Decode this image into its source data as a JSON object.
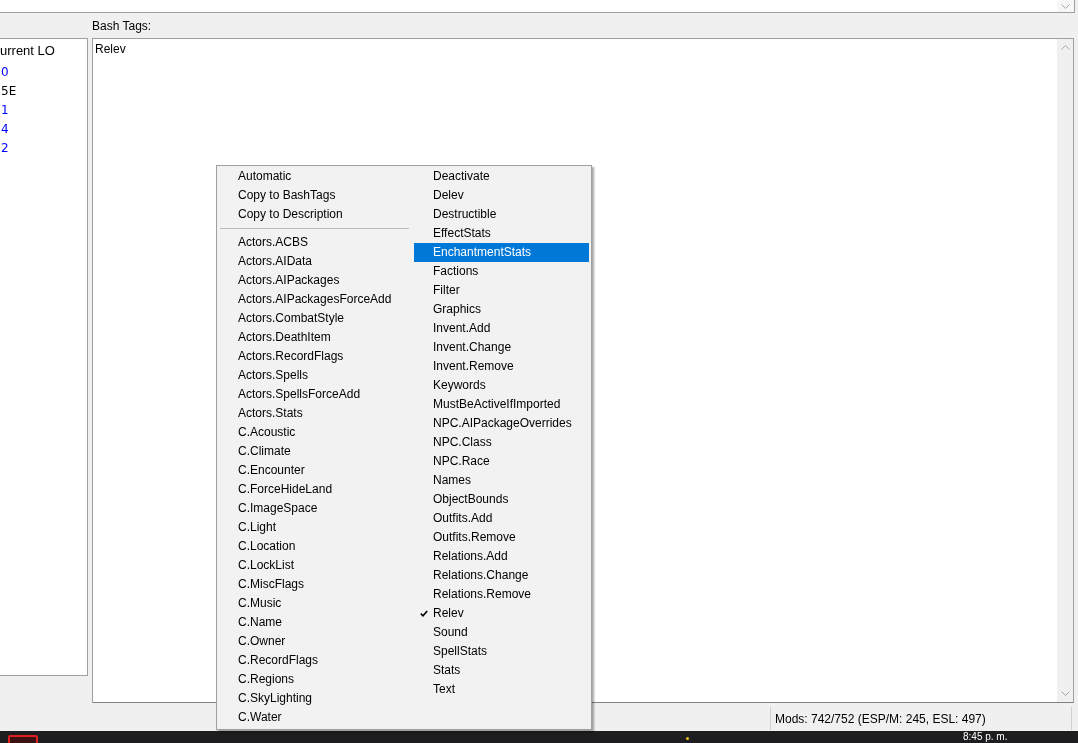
{
  "bash_tags": {
    "label": "Bash Tags:",
    "value": "Relev"
  },
  "load_order": {
    "header": "urrent LO",
    "rows": [
      {
        "text": "0",
        "color": "#0000ff"
      },
      {
        "text": "5E",
        "color": "#000000"
      },
      {
        "text": "1",
        "color": "#0000ff"
      },
      {
        "text": "4",
        "color": "#0000ff"
      },
      {
        "text": "2",
        "color": "#0000ff"
      }
    ]
  },
  "context_menu": {
    "columns": [
      {
        "items": [
          {
            "kind": "action",
            "label": "Automatic",
            "highlighted": false
          },
          {
            "kind": "action",
            "label": "Copy to BashTags",
            "highlighted": false
          },
          {
            "kind": "action",
            "label": "Copy to Description",
            "highlighted": false
          },
          {
            "kind": "separator"
          },
          {
            "kind": "tag",
            "label": "Actors.ACBS",
            "checked": false,
            "highlighted": false
          },
          {
            "kind": "tag",
            "label": "Actors.AIData",
            "checked": false,
            "highlighted": false
          },
          {
            "kind": "tag",
            "label": "Actors.AIPackages",
            "checked": false,
            "highlighted": false
          },
          {
            "kind": "tag",
            "label": "Actors.AIPackagesForceAdd",
            "checked": false,
            "highlighted": false
          },
          {
            "kind": "tag",
            "label": "Actors.CombatStyle",
            "checked": false,
            "highlighted": false
          },
          {
            "kind": "tag",
            "label": "Actors.DeathItem",
            "checked": false,
            "highlighted": false
          },
          {
            "kind": "tag",
            "label": "Actors.RecordFlags",
            "checked": false,
            "highlighted": false
          },
          {
            "kind": "tag",
            "label": "Actors.Spells",
            "checked": false,
            "highlighted": false
          },
          {
            "kind": "tag",
            "label": "Actors.SpellsForceAdd",
            "checked": false,
            "highlighted": false
          },
          {
            "kind": "tag",
            "label": "Actors.Stats",
            "checked": false,
            "highlighted": false
          },
          {
            "kind": "tag",
            "label": "C.Acoustic",
            "checked": false,
            "highlighted": false
          },
          {
            "kind": "tag",
            "label": "C.Climate",
            "checked": false,
            "highlighted": false
          },
          {
            "kind": "tag",
            "label": "C.Encounter",
            "checked": false,
            "highlighted": false
          },
          {
            "kind": "tag",
            "label": "C.ForceHideLand",
            "checked": false,
            "highlighted": false
          },
          {
            "kind": "tag",
            "label": "C.ImageSpace",
            "checked": false,
            "highlighted": false
          },
          {
            "kind": "tag",
            "label": "C.Light",
            "checked": false,
            "highlighted": false
          },
          {
            "kind": "tag",
            "label": "C.Location",
            "checked": false,
            "highlighted": false
          },
          {
            "kind": "tag",
            "label": "C.LockList",
            "checked": false,
            "highlighted": false
          },
          {
            "kind": "tag",
            "label": "C.MiscFlags",
            "checked": false,
            "highlighted": false
          },
          {
            "kind": "tag",
            "label": "C.Music",
            "checked": false,
            "highlighted": false
          },
          {
            "kind": "tag",
            "label": "C.Name",
            "checked": false,
            "highlighted": false
          },
          {
            "kind": "tag",
            "label": "C.Owner",
            "checked": false,
            "highlighted": false
          },
          {
            "kind": "tag",
            "label": "C.RecordFlags",
            "checked": false,
            "highlighted": false
          },
          {
            "kind": "tag",
            "label": "C.Regions",
            "checked": false,
            "highlighted": false
          },
          {
            "kind": "tag",
            "label": "C.SkyLighting",
            "checked": false,
            "highlighted": false
          },
          {
            "kind": "tag",
            "label": "C.Water",
            "checked": false,
            "highlighted": false
          }
        ]
      },
      {
        "items": [
          {
            "kind": "tag",
            "label": "Deactivate",
            "checked": false,
            "highlighted": false
          },
          {
            "kind": "tag",
            "label": "Delev",
            "checked": false,
            "highlighted": false
          },
          {
            "kind": "tag",
            "label": "Destructible",
            "checked": false,
            "highlighted": false
          },
          {
            "kind": "tag",
            "label": "EffectStats",
            "checked": false,
            "highlighted": false
          },
          {
            "kind": "tag",
            "label": "EnchantmentStats",
            "checked": false,
            "highlighted": true
          },
          {
            "kind": "tag",
            "label": "Factions",
            "checked": false,
            "highlighted": false
          },
          {
            "kind": "tag",
            "label": "Filter",
            "checked": false,
            "highlighted": false
          },
          {
            "kind": "tag",
            "label": "Graphics",
            "checked": false,
            "highlighted": false
          },
          {
            "kind": "tag",
            "label": "Invent.Add",
            "checked": false,
            "highlighted": false
          },
          {
            "kind": "tag",
            "label": "Invent.Change",
            "checked": false,
            "highlighted": false
          },
          {
            "kind": "tag",
            "label": "Invent.Remove",
            "checked": false,
            "highlighted": false
          },
          {
            "kind": "tag",
            "label": "Keywords",
            "checked": false,
            "highlighted": false
          },
          {
            "kind": "tag",
            "label": "MustBeActiveIfImported",
            "checked": false,
            "highlighted": false
          },
          {
            "kind": "tag",
            "label": "NPC.AIPackageOverrides",
            "checked": false,
            "highlighted": false
          },
          {
            "kind": "tag",
            "label": "NPC.Class",
            "checked": false,
            "highlighted": false
          },
          {
            "kind": "tag",
            "label": "NPC.Race",
            "checked": false,
            "highlighted": false
          },
          {
            "kind": "tag",
            "label": "Names",
            "checked": false,
            "highlighted": false
          },
          {
            "kind": "tag",
            "label": "ObjectBounds",
            "checked": false,
            "highlighted": false
          },
          {
            "kind": "tag",
            "label": "Outfits.Add",
            "checked": false,
            "highlighted": false
          },
          {
            "kind": "tag",
            "label": "Outfits.Remove",
            "checked": false,
            "highlighted": false
          },
          {
            "kind": "tag",
            "label": "Relations.Add",
            "checked": false,
            "highlighted": false
          },
          {
            "kind": "tag",
            "label": "Relations.Change",
            "checked": false,
            "highlighted": false
          },
          {
            "kind": "tag",
            "label": "Relations.Remove",
            "checked": false,
            "highlighted": false
          },
          {
            "kind": "tag",
            "label": "Relev",
            "checked": true,
            "highlighted": false
          },
          {
            "kind": "tag",
            "label": "Sound",
            "checked": false,
            "highlighted": false
          },
          {
            "kind": "tag",
            "label": "SpellStats",
            "checked": false,
            "highlighted": false
          },
          {
            "kind": "tag",
            "label": "Stats",
            "checked": false,
            "highlighted": false
          },
          {
            "kind": "tag",
            "label": "Text",
            "checked": false,
            "highlighted": false
          }
        ]
      }
    ]
  },
  "status_bar": {
    "mods": "Mods: 742/752 (ESP/M: 245, ESL: 497)"
  },
  "taskbar": {
    "clock": "8:45 p. m."
  }
}
